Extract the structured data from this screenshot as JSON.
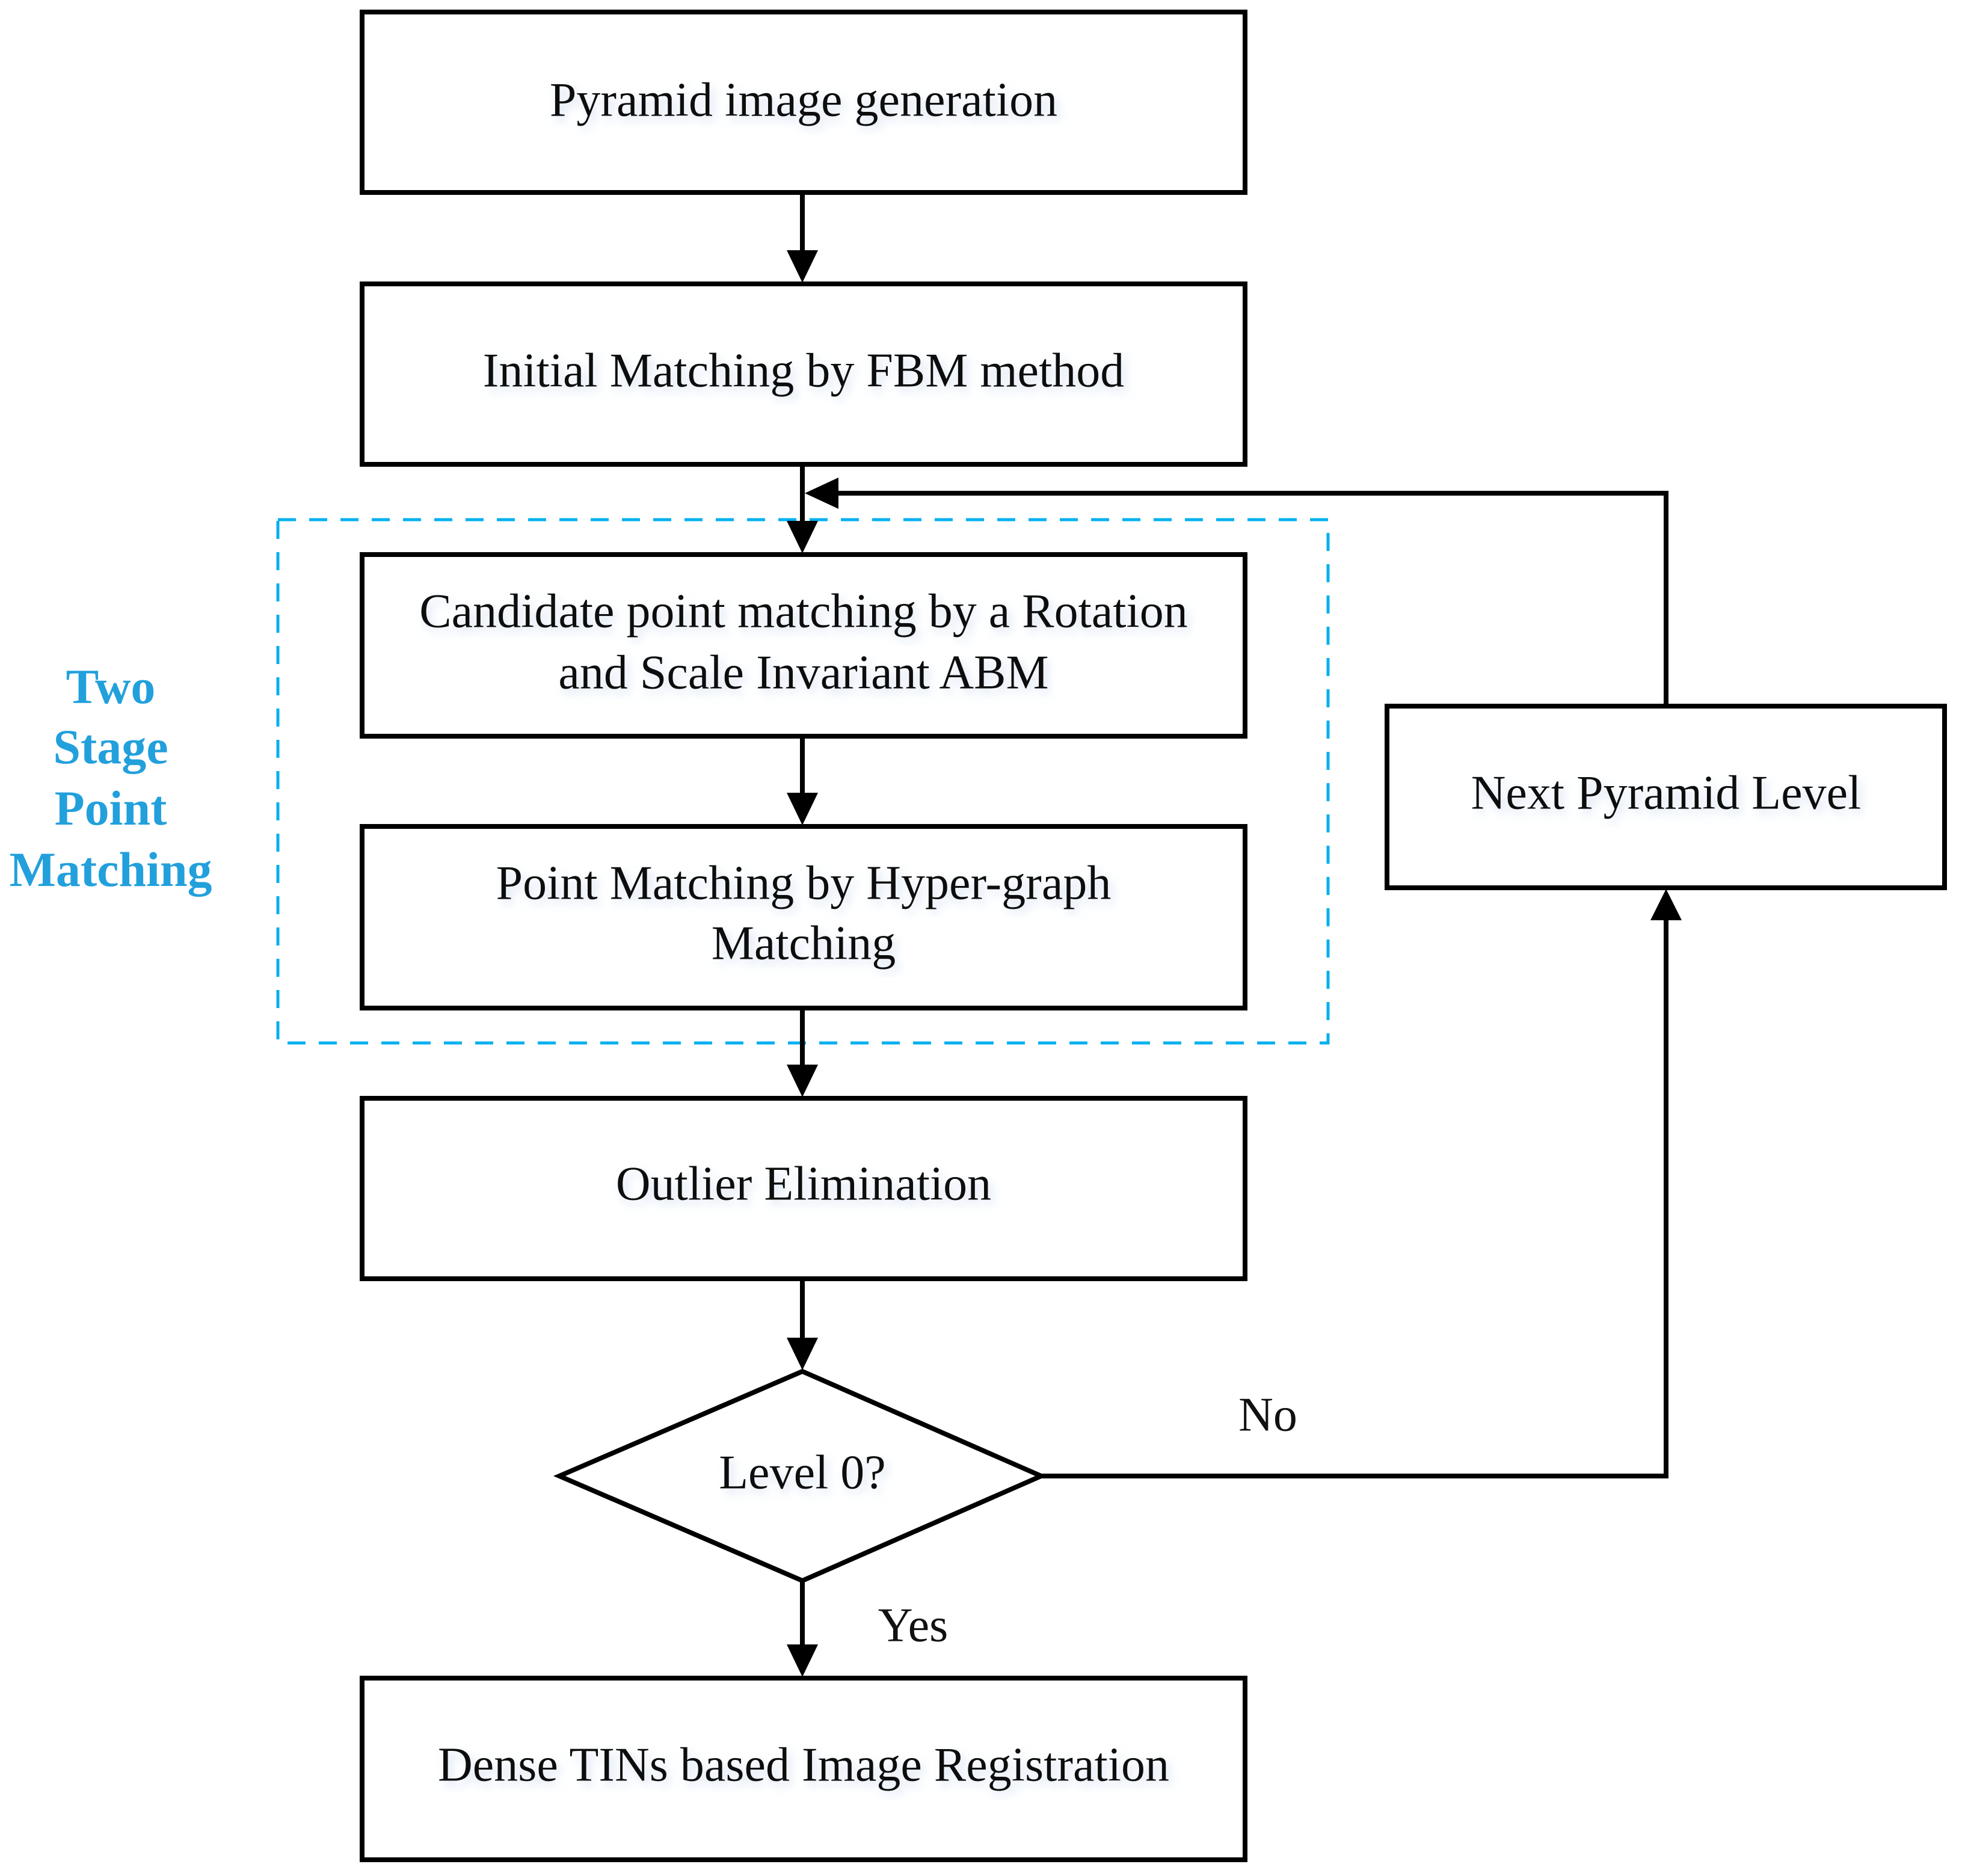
{
  "colors": {
    "group_border": "#00b0f0",
    "group_label": "#22a0dc",
    "box_border": "#000000"
  },
  "steps": {
    "pyramid": "Pyramid image generation",
    "initial": "Initial Matching by FBM method",
    "candidate_line1": "Candidate point matching by a Rotation",
    "candidate_line2": "and Scale Invariant ABM",
    "hyper_line1": "Point Matching by Hyper-graph",
    "hyper_line2": "Matching",
    "outlier": "Outlier Elimination",
    "decision": "Level 0?",
    "dense": "Dense TINs based Image Registration",
    "next": "Next Pyramid Level"
  },
  "edges": {
    "no": "No",
    "yes": "Yes"
  },
  "group": {
    "label_lines": [
      "Two",
      "Stage",
      "Point",
      "Matching"
    ]
  }
}
